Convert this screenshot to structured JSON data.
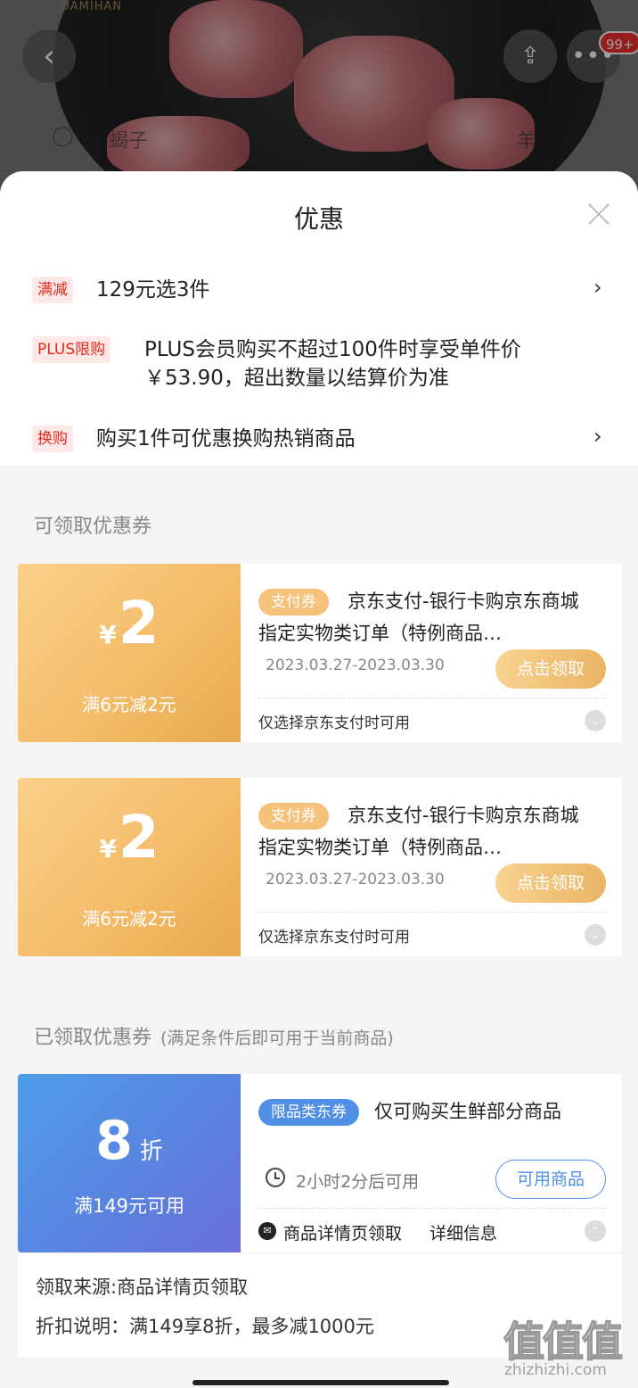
{
  "background": {
    "brand": "DAMIHAN",
    "badge": "99+",
    "tabs": [
      "羊蝎子",
      "羊蝎子"
    ]
  },
  "sheet": {
    "title": "优惠",
    "promos": [
      {
        "tag": "满减",
        "text": "129元选3件"
      },
      {
        "tag": "PLUS限购",
        "text_line1": "PLUS会员购买不超过100件时享受单件价",
        "text_line2": "￥53.90，超出数量以结算价为准"
      },
      {
        "tag": "换购",
        "text": "购买1件可优惠换购热销商品"
      }
    ],
    "available_label": "可领取优惠券",
    "coupons": [
      {
        "currency": "¥",
        "amount": "2",
        "condition": "满6元减2元",
        "type": "支付券",
        "description": "京东支付-银行卡购京东商城指定实物类订单（特例商品…",
        "date": "2023.03.27-2023.03.30",
        "button": "点击领取",
        "note": "仅选择京东支付时可用"
      },
      {
        "currency": "¥",
        "amount": "2",
        "condition": "满6元减2元",
        "type": "支付券",
        "description": "京东支付-银行卡购京东商城指定实物类订单（特例商品…",
        "date": "2023.03.27-2023.03.30",
        "button": "点击领取",
        "note": "仅选择京东支付时可用"
      }
    ],
    "claimed_label": "已领取优惠券",
    "claimed_hint": "(满足条件后即可用于当前商品)",
    "claimed_coupon": {
      "discount": "8",
      "unit": "折",
      "condition": "满149元可用",
      "type": "限品类东券",
      "description": "仅可购买生鲜部分商品",
      "timer": "2小时2分后可用",
      "button": "可用商品",
      "source": "商品详情页领取",
      "detail": "详细信息"
    },
    "info": {
      "source_line": "领取来源:商品详情页领取",
      "discount_line": "折扣说明：满149享8折，最多减1000元"
    }
  },
  "watermark": {
    "text": "值值值",
    "url": "zhizhizhi.com"
  }
}
